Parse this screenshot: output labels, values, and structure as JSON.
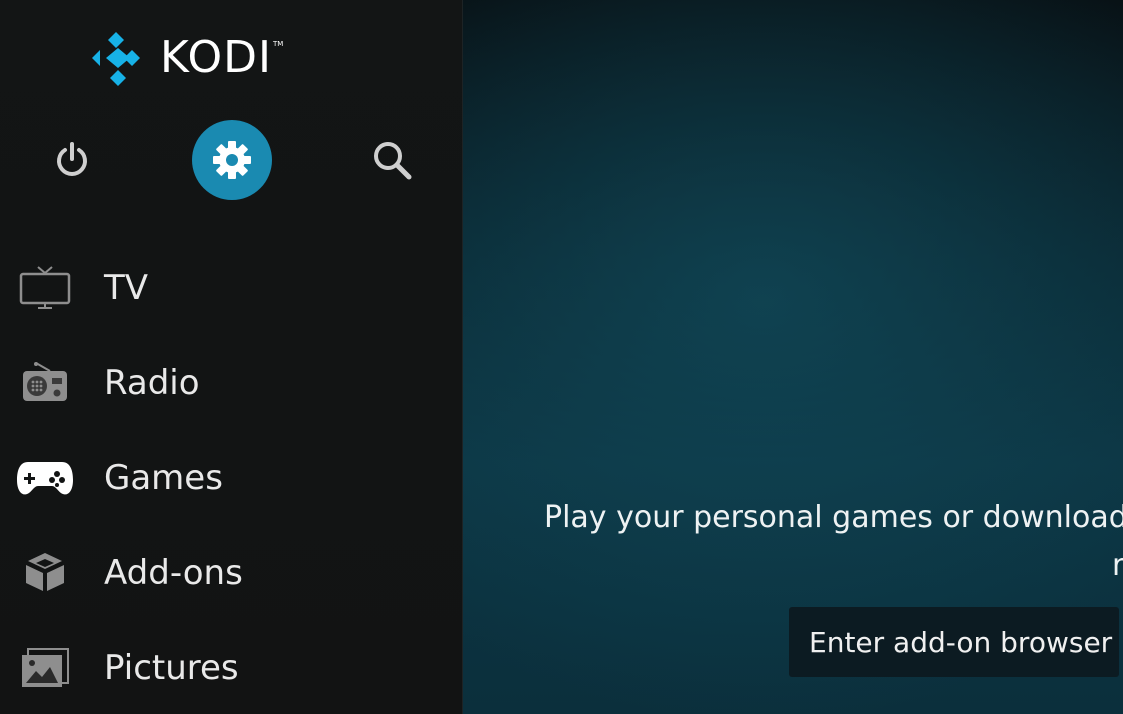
{
  "app": {
    "logo_text": "KODI",
    "logo_tm": "TM",
    "brand_color": "#1a8ab1"
  },
  "top_buttons": [
    {
      "name": "power",
      "icon": "power-icon",
      "active": false
    },
    {
      "name": "settings",
      "icon": "gear-icon",
      "active": true
    },
    {
      "name": "search",
      "icon": "search-icon",
      "active": false
    }
  ],
  "menu": {
    "items": [
      {
        "label": "TV",
        "icon": "tv-icon"
      },
      {
        "label": "Radio",
        "icon": "radio-icon"
      },
      {
        "label": "Games",
        "icon": "gamepad-icon",
        "focused": true
      },
      {
        "label": "Add-ons",
        "icon": "box-icon"
      },
      {
        "label": "Pictures",
        "icon": "picture-icon"
      }
    ]
  },
  "main": {
    "promo_line1": "Play your personal games or download",
    "promo_line2": "r",
    "addon_button_label": "Enter add-on browser"
  }
}
